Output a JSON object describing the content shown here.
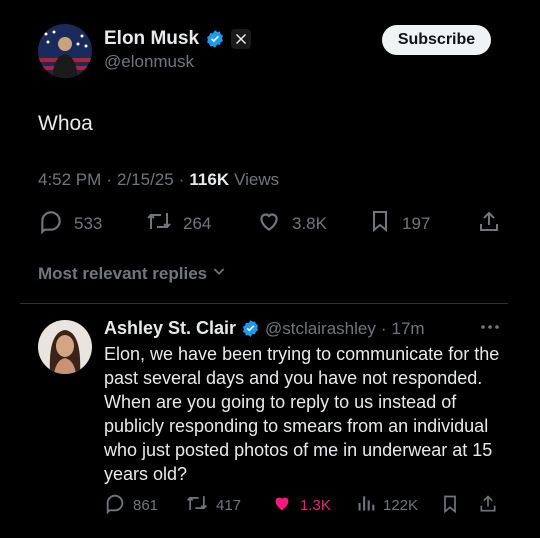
{
  "tweet": {
    "author_name": "Elon Musk",
    "author_handle": "@elonmusk",
    "subscribe_label": "Subscribe",
    "text": "Whoa",
    "time": "4:52 PM",
    "date": "2/15/25",
    "separator": "·",
    "views_count": "116K",
    "views_label": "Views",
    "stats": {
      "replies": "533",
      "retweets": "264",
      "likes": "3.8K",
      "bookmarks": "197"
    }
  },
  "replies_filter": "Most relevant replies",
  "reply": {
    "author_name": "Ashley St. Clair",
    "author_handle": "@stclairashley",
    "separator": "·",
    "age": "17m",
    "text": "Elon, we have been trying to communicate for the past several days and you have not responded. When are you going to reply to us instead of publicly responding to smears from an individual who just posted photos of me in underwear at 15 years old?",
    "stats": {
      "replies": "861",
      "retweets": "417",
      "likes": "1.3K",
      "views": "122K"
    }
  },
  "colors": {
    "verified": "#1d9bf0",
    "like_active": "#f91880",
    "muted": "#71767b",
    "text": "#e7e9ea"
  },
  "icons": [
    "x-logo-icon",
    "verified-badge-icon",
    "reply-icon",
    "retweet-icon",
    "heart-icon",
    "bookmark-icon",
    "share-icon",
    "chevron-down-icon",
    "more-icon",
    "views-icon"
  ]
}
